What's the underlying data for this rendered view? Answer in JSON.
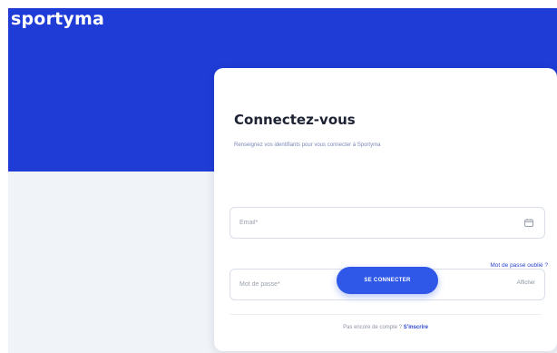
{
  "header": {
    "logo_text": "sportyma",
    "background_color": "#1f3cd6"
  },
  "login": {
    "title": "Connectez-vous",
    "subtitle": "Renseignez vos identifiants pour vous connecter à Sportyma",
    "email_placeholder": "Email*",
    "email_value": "",
    "email_icon": "calendar-icon",
    "password_placeholder": "Mot de passe*",
    "password_value": "",
    "show_password_label": "Afficher",
    "forgot_password_label": "Mot de passe oublié ?",
    "submit_label": "SE CONNECTER",
    "signup_prompt": "Pas encore de compte ?",
    "signup_link_label": "S'inscrire",
    "accent_color": "#2f58e8"
  }
}
